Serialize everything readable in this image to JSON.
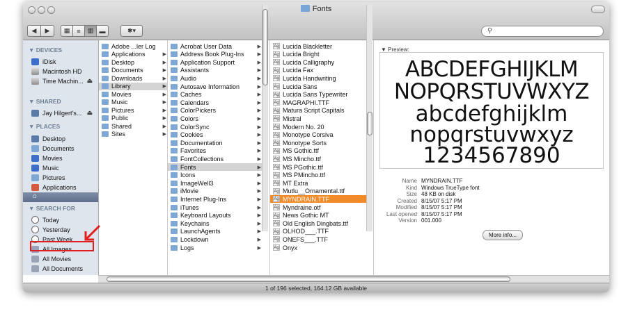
{
  "window": {
    "title": "Fonts"
  },
  "toolbar": {
    "action_label": "✱▾",
    "search_placeholder": ""
  },
  "sidebar": {
    "sections": [
      {
        "heading": "▼ DEVICES",
        "items": [
          "iDisk",
          "Macintosh HD",
          "Time Machin..."
        ]
      },
      {
        "heading": "▼ SHARED",
        "items": [
          "Jay Hilgert's..."
        ]
      },
      {
        "heading": "▼ PLACES",
        "items": [
          "Desktop",
          "Documents",
          "Movies",
          "Music",
          "Pictures",
          "Applications"
        ]
      },
      {
        "heading": "▼ SEARCH FOR",
        "items": [
          "Today",
          "Yesterday",
          "Past Week",
          "All Images",
          "All Movies",
          "All Documents"
        ]
      }
    ]
  },
  "col1": [
    "Adobe ...ler Log",
    "Applications",
    "Desktop",
    "Documents",
    "Downloads",
    "Library",
    "Movies",
    "Music",
    "Pictures",
    "Public",
    "Shared",
    "Sites"
  ],
  "col2": [
    "Acrobat User Data",
    "Address Book Plug-Ins",
    "Application Support",
    "Assistants",
    "Audio",
    "Autosave Information",
    "Caches",
    "Calendars",
    "ColorPickers",
    "Colors",
    "ColorSync",
    "Cookies",
    "Documentation",
    "Favorites",
    "FontCollections",
    "Fonts",
    "Icons",
    "ImageWell3",
    "iMovie",
    "Internet Plug-Ins",
    "iTunes",
    "Keyboard Layouts",
    "Keychains",
    "LaunchAgents",
    "Lockdown",
    "Logs"
  ],
  "col3": [
    "Lucida Blackletter",
    "Lucida Bright",
    "Lucida Calligraphy",
    "Lucida Fax",
    "Lucida Handwriting",
    "Lucida Sans",
    "Lucida Sans Typewriter",
    "MAGRAPHI.TTF",
    "Matura Script Capitals",
    "Mistral",
    "Modern No. 20",
    "Monotype Corsiva",
    "Monotype Sorts",
    "MS Gothic.ttf",
    "MS Mincho.ttf",
    "MS PGothic.ttf",
    "MS PMincho.ttf",
    "MT Extra",
    "Mutlu__Ornamental.ttf",
    "MYNDRAIN.TTF",
    "Myndraine.otf",
    "News Gothic MT",
    "Old English Dingbats.ttf",
    "OLHOD___.TTF",
    "ONEFS___.TTF",
    "Onyx"
  ],
  "preview": {
    "label": "▼ Preview:",
    "lines": [
      "ABCDEFGHIJKLM",
      "NOPQRSTUVWXYZ",
      "abcdefghijklm",
      "nopqrstuvwxyz",
      "1234567890"
    ]
  },
  "info": [
    {
      "key": "Name",
      "value": "MYNDRAIN.TTF"
    },
    {
      "key": "Kind",
      "value": "Windows TrueType font"
    },
    {
      "key": "Size",
      "value": "48 KB on disk"
    },
    {
      "key": "Created",
      "value": "8/15/07 5:17 PM"
    },
    {
      "key": "Modified",
      "value": "8/15/07 5:17 PM"
    },
    {
      "key": "Last opened",
      "value": "8/15/07 5:17 PM"
    },
    {
      "key": "Version",
      "value": "001.000"
    }
  ],
  "more_info_label": "More info...",
  "status": "1 of 196 selected, 164.12 GB available",
  "colors": {
    "selection_orange": "#f28c2a",
    "sidebar_bg": "#dfe5ed",
    "annotation_red": "#e02020"
  }
}
